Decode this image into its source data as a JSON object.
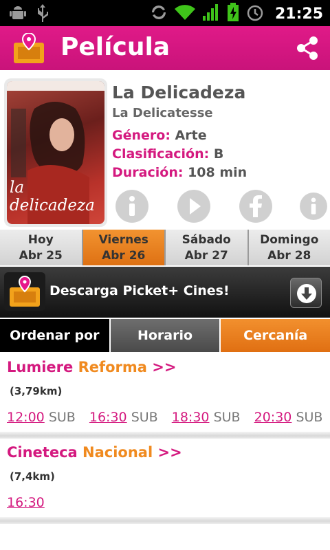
{
  "status_bar": {
    "time": "21:25",
    "icons": [
      "android-debug-icon",
      "usb-icon",
      "sync-icon",
      "wifi-icon",
      "signal-icon",
      "battery-icon",
      "alarm-icon"
    ]
  },
  "app_bar": {
    "title": "Película",
    "share_icon": "share-icon",
    "accent": "#d4197f"
  },
  "movie": {
    "title": "La Delicadeza",
    "original_title": "La Delicatesse",
    "poster_text": "la delicadeza",
    "genre_label": "Género:",
    "genre": "Arte",
    "rating_label": "Clasificación:",
    "rating": "B",
    "duration_label": "Duración:",
    "duration": "108 min",
    "actions": [
      "info-icon",
      "play-icon",
      "facebook-icon",
      "info-icon"
    ]
  },
  "days": [
    {
      "name": "Hoy",
      "date": "Abr 25",
      "active": false
    },
    {
      "name": "Viernes",
      "date": "Abr 26",
      "active": true
    },
    {
      "name": "Sábado",
      "date": "Abr 27",
      "active": false
    },
    {
      "name": "Domingo",
      "date": "Abr 28",
      "active": false
    }
  ],
  "banner": {
    "text": "Descarga Picket+ Cines!",
    "icon": "download-icon"
  },
  "sort": {
    "label": "Ordenar por",
    "options": [
      "Horario",
      "Cercanía"
    ],
    "selected": "Cercanía"
  },
  "cinemas": [
    {
      "name_a": "Lumiere",
      "name_b": "Reforma",
      "arrows": ">>",
      "distance": "(3,79km)",
      "showtimes": [
        {
          "time": "12:00",
          "format": "SUB"
        },
        {
          "time": "16:30",
          "format": "SUB"
        },
        {
          "time": "18:30",
          "format": "SUB"
        },
        {
          "time": "20:30",
          "format": "SUB"
        }
      ]
    },
    {
      "name_a": "Cineteca",
      "name_b": "Nacional",
      "arrows": ">>",
      "distance": "(7,4km)",
      "showtimes": [
        {
          "time": "16:30",
          "format": ""
        }
      ]
    }
  ]
}
